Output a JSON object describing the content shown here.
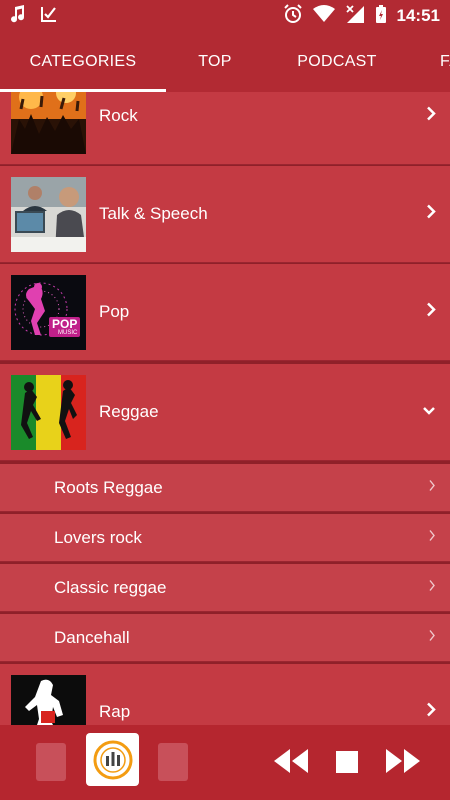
{
  "status": {
    "time": "14:51"
  },
  "tabs": [
    {
      "label": "CATEGORIES",
      "active": true
    },
    {
      "label": "TOP",
      "active": false
    },
    {
      "label": "PODCAST",
      "active": false
    },
    {
      "label": "FA",
      "active": false
    }
  ],
  "categories": [
    {
      "label": "Rock",
      "icon": "chevron-right-icon"
    },
    {
      "label": "Talk & Speech",
      "icon": "chevron-right-icon"
    },
    {
      "label": "Pop",
      "icon": "chevron-right-icon"
    },
    {
      "label": "Reggae",
      "icon": "chevron-down-icon",
      "expanded": true
    },
    {
      "label": "Rap",
      "icon": "chevron-right-icon"
    }
  ],
  "subcategories": [
    {
      "label": "Roots Reggae"
    },
    {
      "label": "Lovers rock"
    },
    {
      "label": "Classic reggae"
    },
    {
      "label": "Dancehall"
    }
  ],
  "thumbnails": {
    "pop_badge": "POP",
    "pop_badge_sub": "MUSIC"
  },
  "colors": {
    "primary": "#b22a33",
    "row": "#c43a43",
    "accent": "#f39c12"
  }
}
